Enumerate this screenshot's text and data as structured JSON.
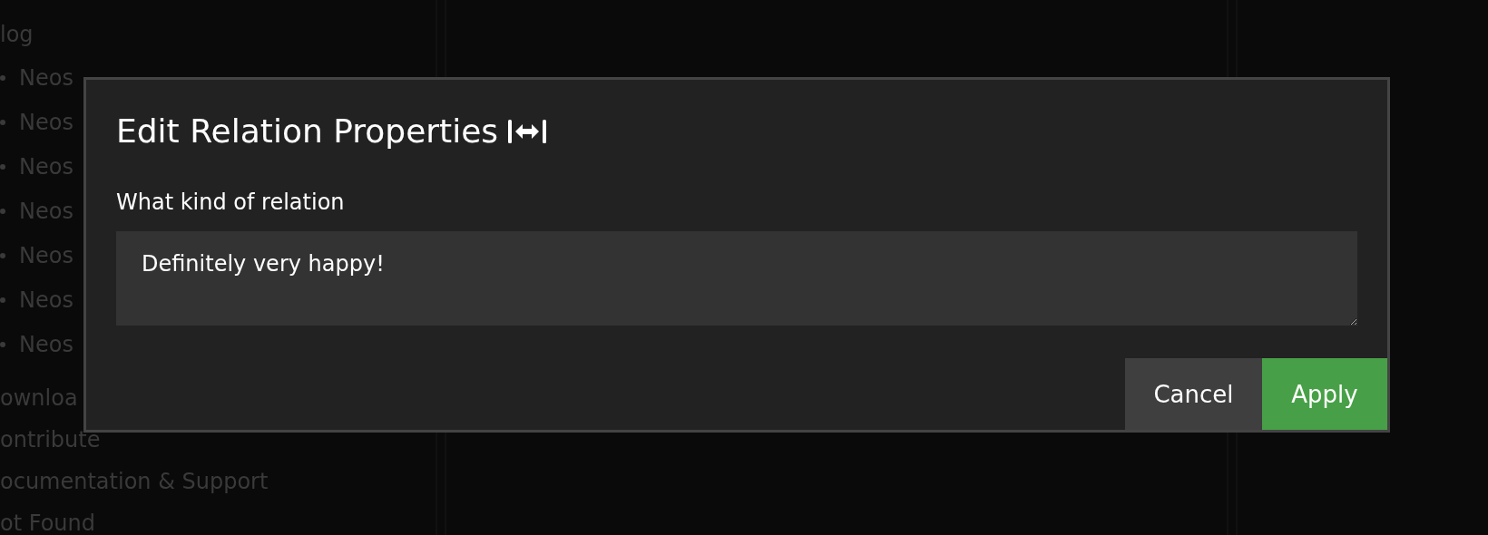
{
  "background_nav": {
    "items": [
      {
        "label": "log",
        "kind": "top"
      },
      {
        "label": "Neos",
        "kind": "sub"
      },
      {
        "label": "Neos",
        "kind": "sub"
      },
      {
        "label": "Neos",
        "kind": "sub"
      },
      {
        "label": "Neos",
        "kind": "sub"
      },
      {
        "label": "Neos",
        "kind": "sub"
      },
      {
        "label": "Neos",
        "kind": "sub"
      },
      {
        "label": "Neos",
        "kind": "sub"
      },
      {
        "label": "ownloa",
        "kind": "top"
      },
      {
        "label": "ontribute",
        "kind": "top"
      },
      {
        "label": "ocumentation & Support",
        "kind": "top"
      },
      {
        "label": "ot Found",
        "kind": "top"
      }
    ]
  },
  "dialog": {
    "title": "Edit Relation Properties",
    "field_label": "What kind of relation",
    "field_value": "Definitely very happy!",
    "buttons": [
      {
        "label": "Cancel",
        "kind": "secondary"
      },
      {
        "label": "Apply",
        "kind": "primary"
      }
    ]
  }
}
